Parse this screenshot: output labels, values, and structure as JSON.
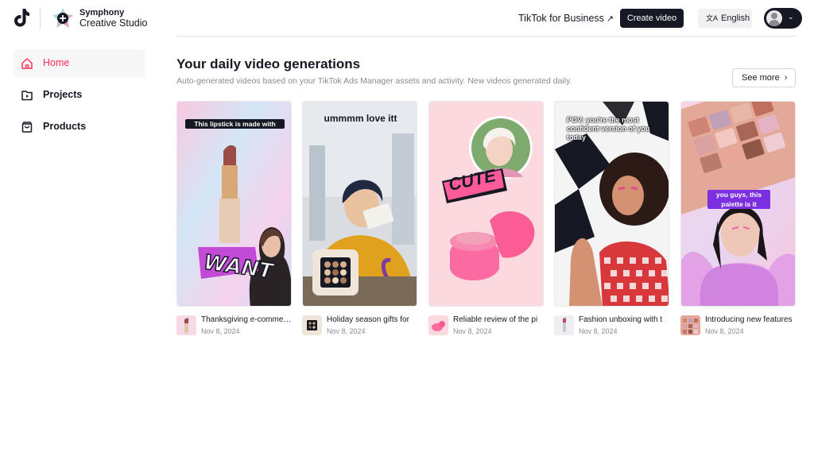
{
  "header": {
    "brand_line1": "Symphony",
    "brand_line2": "Creative Studio",
    "business_link": "TikTok for Business",
    "create_button": "Create video",
    "language": "English"
  },
  "sidebar": {
    "items": [
      {
        "label": "Home",
        "icon": "home-icon",
        "active": true
      },
      {
        "label": "Projects",
        "icon": "projects-icon",
        "active": false
      },
      {
        "label": "Products",
        "icon": "shopping-bag-icon",
        "active": false
      }
    ]
  },
  "main": {
    "title": "Your daily video generations",
    "subtitle": "Auto-generated videos based on your TikTok Ads Manager assets and activity. New videos generated daily.",
    "see_more": "See more",
    "cards": [
      {
        "title": "Thanksgiving e-commerce",
        "date": "Nov 8, 2024",
        "caption": "This lipstick is made with",
        "sticker": "WANT"
      },
      {
        "title": "Holiday season gifts for",
        "date": "Nov 8, 2024",
        "caption": "ummmm love itt"
      },
      {
        "title": "Reliable review of the pi",
        "date": "Nov 8, 2024",
        "sticker": "CUTE"
      },
      {
        "title": "Fashion unboxing with t",
        "date": "Nov 8, 2024",
        "caption": "POV: you're the most confident version of you today"
      },
      {
        "title": "Introducing new features",
        "date": "Nov 8, 2024",
        "caption": "you guys, this palette is it"
      }
    ]
  },
  "colors": {
    "accent": "#fe2c55",
    "dark": "#161823",
    "muted": "#8a8b91"
  }
}
